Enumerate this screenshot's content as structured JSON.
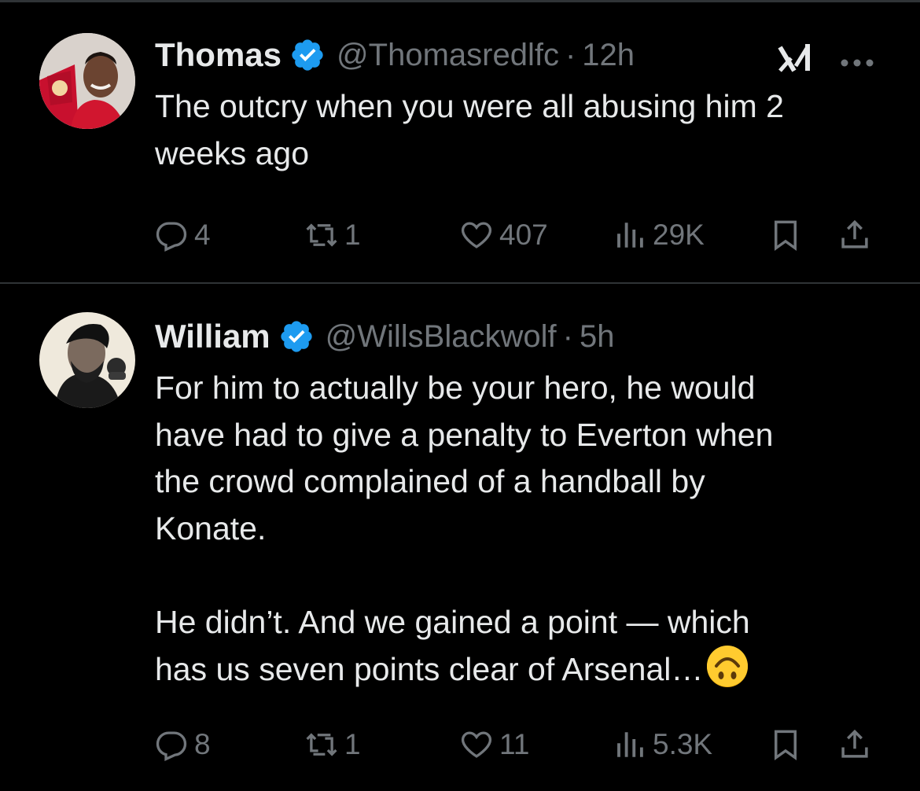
{
  "tweets": [
    {
      "name": "Thomas",
      "handle": "@Thomasredlfc",
      "separator": "·",
      "time": "12h",
      "text": "The outcry when you were all abusing him 2\nweeks ago",
      "replies": "4",
      "reposts": "1",
      "likes": "407",
      "views": "29K"
    },
    {
      "name": "William",
      "handle": "@WillsBlackwolf",
      "separator": "·",
      "time": "5h",
      "text": "For him to actually be your hero, he would\nhave had to give a penalty to Everton when\nthe crowd complained of a handball by\nKonate.\n\nHe didn’t. And we gained a point — which\nhas us seven points clear of Arsenal…",
      "replies": "8",
      "reposts": "1",
      "likes": "11",
      "views": "5.3K"
    }
  ],
  "icons": {
    "verified": "verified-badge-icon",
    "grok": "grok-icon",
    "more": "more-icon",
    "reply": "reply-icon",
    "repost": "repost-icon",
    "like": "like-icon",
    "views": "views-icon",
    "bookmark": "bookmark-icon",
    "share": "share-icon",
    "emoji": "upside-down-face-emoji"
  },
  "colors": {
    "background": "#000000",
    "text": "#e7e9ea",
    "muted": "#71767b",
    "verified": "#1d9bf0",
    "divider": "#2f3336"
  }
}
